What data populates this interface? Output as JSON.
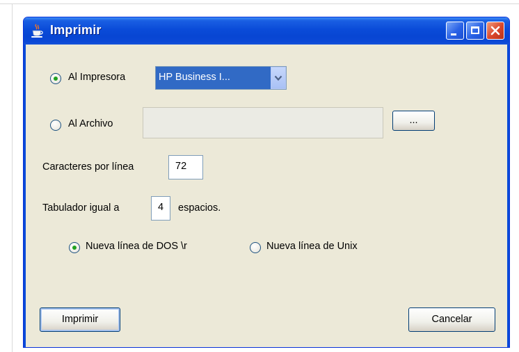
{
  "window": {
    "title": "Imprimir",
    "controls": {
      "minimize": "minimize-icon",
      "maximize": "maximize-icon",
      "close": "close-icon"
    }
  },
  "output": {
    "printer_option": {
      "label": "Al Impresora",
      "selected": true
    },
    "printer_select": {
      "value": "HP Business I..."
    },
    "file_option": {
      "label": "Al Archivo",
      "selected": false
    },
    "file_path": {
      "value": "",
      "enabled": false
    },
    "browse_label": "..."
  },
  "settings": {
    "chars_label": "Caracteres por línea",
    "chars_value": "72",
    "tab_label": "Tabulador igual a",
    "tab_value": "4",
    "tab_suffix": "espacios."
  },
  "newline": {
    "dos": {
      "label": "Nueva línea de DOS \\r",
      "selected": true
    },
    "unix": {
      "label": "Nueva línea de Unix",
      "selected": false
    }
  },
  "actions": {
    "print_label": "Imprimir",
    "cancel_label": "Cancelar"
  },
  "colors": {
    "titlebar": "#0a4bd8",
    "dialog_bg": "#ece9d8",
    "selection": "#316ac5",
    "radio_dot": "#21a121",
    "close_button": "#d9452a"
  }
}
